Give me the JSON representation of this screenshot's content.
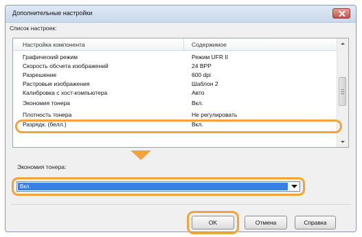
{
  "window": {
    "title": "Дополнительные настройки"
  },
  "list": {
    "label": "Список настроек:",
    "columns": [
      "Настройка компонента",
      "Содержимое"
    ],
    "rows": [
      {
        "name": "Графический режим",
        "value": "Режим UFR II"
      },
      {
        "name": "Скорость обсчета изображений",
        "value": "24 BPP"
      },
      {
        "name": "Разрешение",
        "value": "600 dpi"
      },
      {
        "name": "Растровые изображения",
        "value": "Шаблон 2"
      },
      {
        "name": "Калибровка с хост-компьютера",
        "value": "Авто"
      },
      {
        "name": "Экономия тонера",
        "value": "Вкл."
      },
      {
        "name": "Плотность тонера",
        "value": "Не регулировать"
      },
      {
        "name": "Разрядк. (белл.)",
        "value": "Вкл."
      }
    ]
  },
  "toner": {
    "label": "Экономия тонера:",
    "selected": "Вкл."
  },
  "buttons": {
    "ok": "OK",
    "cancel": "Отмена",
    "help": "Справка"
  },
  "colors": {
    "highlight": "#f4a23c",
    "selection": "#3a7fe0"
  },
  "icons": {
    "close": "close-icon",
    "arrow": "chevron-down-icon",
    "pointer": "pointer-triangle-icon"
  }
}
